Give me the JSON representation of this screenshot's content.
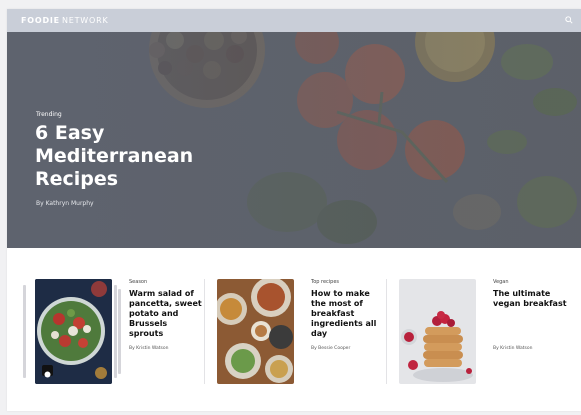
{
  "topbar": {
    "brand_bold": "FOODIE",
    "brand_light": "NETWORK"
  },
  "hero": {
    "kicker": "Trending",
    "title": "6 Easy Mediterranean Recipes",
    "author": "By Kathryn Murphy"
  },
  "cards": [
    {
      "kicker": "Season",
      "title": "Warm salad of pancetta, sweet potato and Brussels sprouts",
      "author": "By Kristin Watson"
    },
    {
      "kicker": "Top recipes",
      "title": "How to make the most of breakfast ingredients all day",
      "author": "By Bessie Cooper"
    },
    {
      "kicker": "Vegan",
      "title": "The ultimate vegan breakfast",
      "author": "By Kristin Watson"
    }
  ],
  "icons": {
    "search": "search-icon",
    "video": "play-icon"
  }
}
